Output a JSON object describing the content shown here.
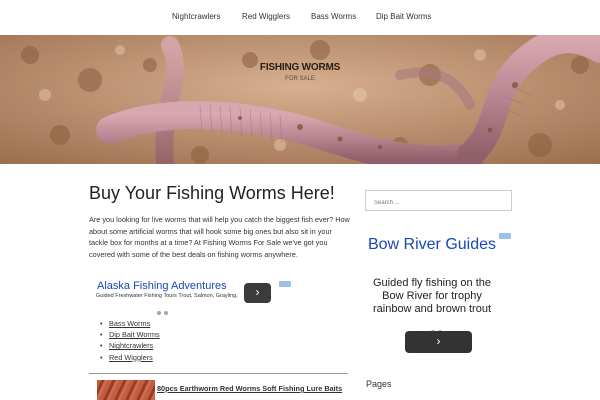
{
  "nav": {
    "items": [
      {
        "label": "Nightcrawlers"
      },
      {
        "label": "Red Wigglers"
      },
      {
        "label": "Bass Worms"
      },
      {
        "label": "Dip Bait Worms"
      }
    ]
  },
  "header": {
    "site_title": "FISHING WORMS",
    "tagline": "FOR SALE"
  },
  "main": {
    "title": "Buy Your Fishing Worms Here!",
    "intro": "Are you looking for live worms that will help you catch the biggest fish ever?  How about some artificial worms that will hook some big ones but also sit in your tackle box for months at a time?  At Fishing Worms For Sale we've got you covered with some of the best deals on fishing worms anywhere.",
    "inline_ad": {
      "title": "Alaska Fishing Adventures",
      "subtitle": "Guided Freshwater Fishing Tours Trout, Salmon, Grayling,",
      "arrow": "›"
    },
    "category_links": [
      {
        "label": "Bass Worms"
      },
      {
        "label": "Dip Bait Worms"
      },
      {
        "label": "Nightcrawlers"
      },
      {
        "label": "Red Wigglers"
      }
    ],
    "product": {
      "title": "80pcs Earthworm Red Worms Soft Fishing Lure Baits"
    }
  },
  "sidebar": {
    "search_placeholder": "Search ...",
    "ad": {
      "title": "Bow River Guides",
      "description": "Guided fly fishing on the Bow River for trophy rainbow and brown trout",
      "arrow": "›"
    },
    "pages_title": "Pages"
  },
  "colors": {
    "ad_link": "#1a47b6",
    "ad_button": "#333333"
  }
}
